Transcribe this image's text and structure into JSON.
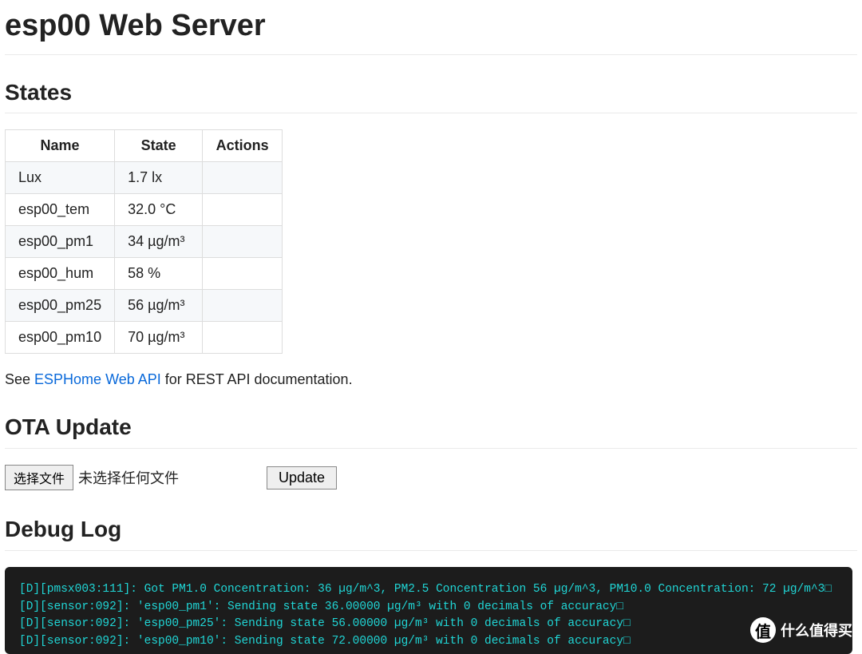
{
  "page": {
    "title": "esp00 Web Server"
  },
  "states": {
    "heading": "States",
    "headers": {
      "name": "Name",
      "state": "State",
      "actions": "Actions"
    },
    "rows": [
      {
        "name": "Lux",
        "state": "1.7 lx",
        "actions": ""
      },
      {
        "name": "esp00_tem",
        "state": "32.0 °C",
        "actions": ""
      },
      {
        "name": "esp00_pm1",
        "state": "34 µg/m³",
        "actions": ""
      },
      {
        "name": "esp00_hum",
        "state": "58 %",
        "actions": ""
      },
      {
        "name": "esp00_pm25",
        "state": "56 µg/m³",
        "actions": ""
      },
      {
        "name": "esp00_pm10",
        "state": "70 µg/m³",
        "actions": ""
      }
    ]
  },
  "api_note": {
    "prefix": "See ",
    "link_text": "ESPHome Web API",
    "suffix": " for REST API documentation."
  },
  "ota": {
    "heading": "OTA Update",
    "choose_label": "选择文件",
    "no_file": "未选择任何文件",
    "update_label": "Update"
  },
  "debug": {
    "heading": "Debug Log",
    "lines": [
      "[D][pmsx003:111]: Got PM1.0 Concentration: 36 µg/m^3, PM2.5 Concentration 56 µg/m^3, PM10.0 Concentration: 72 µg/m^3□",
      "[D][sensor:092]: 'esp00_pm1': Sending state 36.00000 µg/m³ with 0 decimals of accuracy□",
      "[D][sensor:092]: 'esp00_pm25': Sending state 56.00000 µg/m³ with 0 decimals of accuracy□",
      "[D][sensor:092]: 'esp00_pm10': Sending state 72.00000 µg/m³ with 0 decimals of accuracy□"
    ]
  },
  "watermark": {
    "badge": "值",
    "text": "什么值得买"
  }
}
